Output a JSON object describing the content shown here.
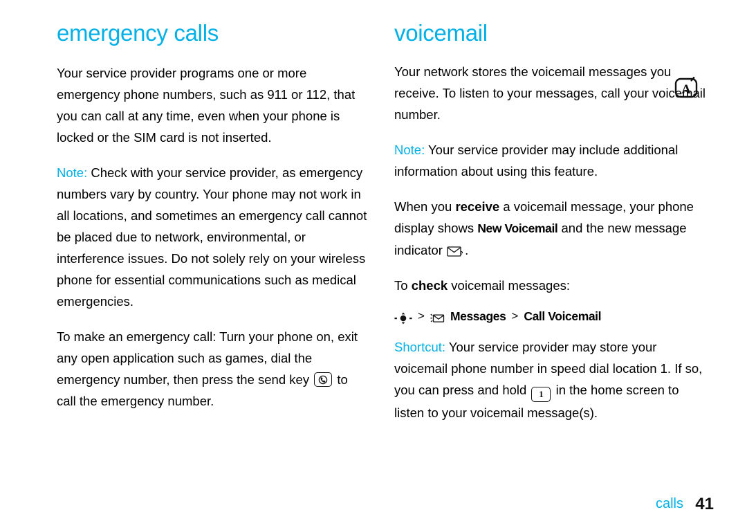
{
  "left_column": {
    "heading": "emergency calls",
    "paragraphs": [
      {
        "id": "p1",
        "text": "Your service provider programs one or more emergency phone numbers, such as 911 or 112, that you can call at any time, even when your phone is locked or the SIM card is not inserted."
      },
      {
        "id": "p2",
        "lead": "Note:",
        "text": "Check with your service provider, as emergency numbers vary by country. Your phone may not work in all locations, and sometimes an emergency call cannot be placed due to network, environmental, or interference issues. Do not solely rely on your wireless phone for essential communications such as medical emergencies."
      },
      {
        "id": "p3",
        "text_before_icon": "To make an emergency call: Turn your phone on, exit any open application such as games, dial the emergency number, then press the send key",
        "icon": "send-key-icon",
        "text_after_icon": "to call the emergency number."
      }
    ]
  },
  "right_column": {
    "heading": "voicemail",
    "paragraphs": [
      {
        "id": "r1",
        "text": "Your network stores the voicemail messages you receive. To listen to your messages, call your voicemail number."
      },
      {
        "id": "r2",
        "lead": "Note:",
        "text": "Your service provider may include additional information about using this feature."
      },
      {
        "id": "r3",
        "seg1": "When you ",
        "bold1": "receive",
        "seg2": " a voicemail message, your phone display shows ",
        "cond1": "New Voicemail",
        "seg3": " and the new message indicator",
        "icon": "envelope-indicator-icon",
        "seg4": "."
      },
      {
        "id": "r4",
        "seg1": "To ",
        "bold1": "check",
        "seg2": " voicemail messages:"
      }
    ],
    "nav_path": {
      "joystick_icon": "joystick-select-icon",
      "separator": ">",
      "messages_icon": "messages-envelope-icon",
      "messages_label": "Messages",
      "call_voicemail_label": "Call Voicemail"
    },
    "shortcut": {
      "lead": "Shortcut:",
      "text_before_key": "Your service provider may store your voicemail phone number in speed dial location 1. If so, you can press and hold",
      "key_label": "1",
      "text_after_key": "in the home screen to listen to your voicemail message(s)."
    },
    "tab_marker_icon": "a-key-tab-icon"
  },
  "footer": {
    "section_label": "calls",
    "page_number": "41"
  },
  "colors": {
    "accent": "#00b0e6",
    "text": "#000000"
  }
}
